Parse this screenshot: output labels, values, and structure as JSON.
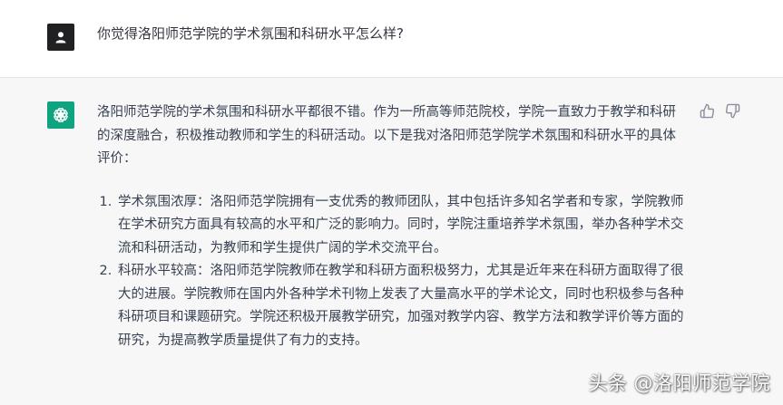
{
  "user_message": {
    "avatar_icon": "user-icon",
    "text": "你觉得洛阳师范学院的学术氛围和科研水平怎么样?"
  },
  "assistant_message": {
    "avatar_icon": "openai-logo-icon",
    "intro": "洛阳师范学院的学术氛围和科研水平都很不错。作为一所高等师范院校，学院一直致力于教学和科研的深度融合，积极推动教师和学生的科研活动。以下是我对洛阳师范学院学术氛围和科研水平的具体评价：",
    "items": [
      {
        "text": "学术氛围浓厚：洛阳师范学院拥有一支优秀的教师团队，其中包括许多知名学者和专家，学院教师在学术研究方面具有较高的水平和广泛的影响力。同时，学院注重培养学术氛围，举办各种学术交流和科研活动，为教师和学生提供广阔的学术交流平台。"
      },
      {
        "text": "科研水平较高：洛阳师范学院教师在教学和科研方面积极努力，尤其是近年来在科研方面取得了很大的进展。学院教师在国内外各种学术刊物上发表了大量高水平的学术论文，同时也积极参与各种科研项目和课题研究。学院还积极开展教学研究，加强对教学内容、教学方法和教学评价等方面的研究，为提高教学质量提供了有力的支持。"
      }
    ],
    "feedback": {
      "thumbs_up_icon": "thumbs-up-icon",
      "thumbs_down_icon": "thumbs-down-icon"
    }
  },
  "watermark": "头条 @洛阳师范学院",
  "colors": {
    "user_bg": "#ffffff",
    "assistant_bg": "#f7f7f8",
    "user_avatar": "#202123",
    "bot_avatar": "#10a37f",
    "text": "#374151"
  }
}
